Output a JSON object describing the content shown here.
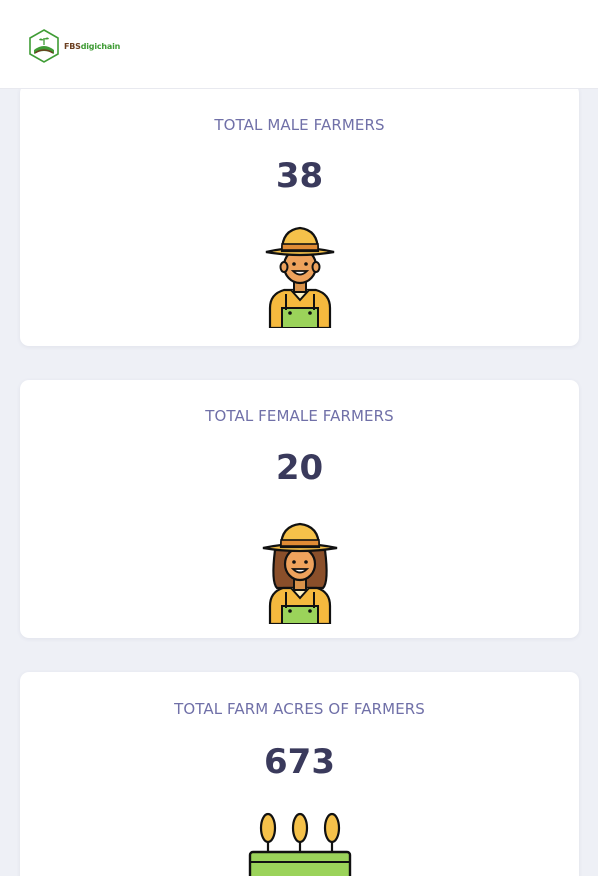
{
  "header": {
    "logo_text_fbs": "FBS",
    "logo_text_rest": "digichain",
    "logo_color_brown": "#6b3e1f",
    "logo_color_green": "#3f9c35"
  },
  "cards": [
    {
      "title": "TOTAL MALE FARMERS",
      "value": "38",
      "icon": "male-farmer-icon"
    },
    {
      "title": "TOTAL FEMALE FARMERS",
      "value": "20",
      "icon": "female-farmer-icon"
    },
    {
      "title": "TOTAL FARM ACRES OF FARMERS",
      "value": "673",
      "icon": "farm-field-icon"
    }
  ],
  "colors": {
    "background": "#eef0f6",
    "card": "#ffffff",
    "title": "#7070a8",
    "value": "#3a3a5c"
  }
}
